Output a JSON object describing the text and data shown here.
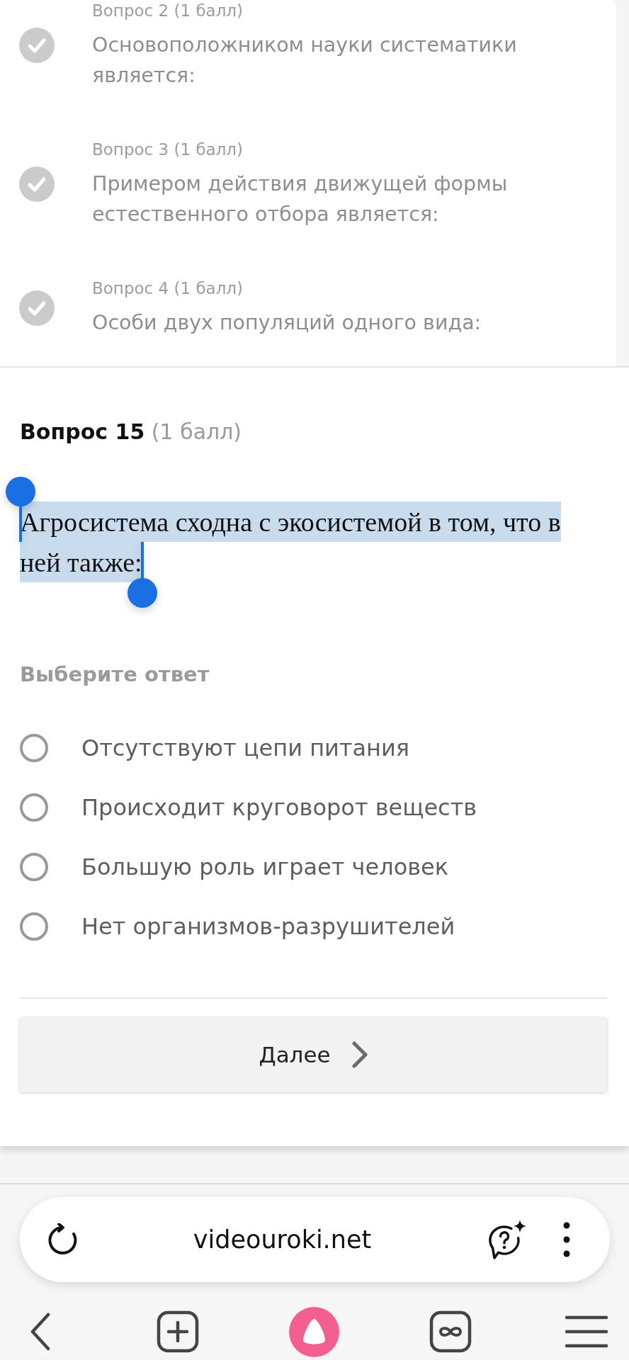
{
  "question_list": {
    "items": [
      {
        "label": "Вопрос 2 (1 балл)",
        "text": "Основоположником науки систематики является:",
        "answered": true
      },
      {
        "label": "Вопрос 3 (1 балл)",
        "text": "Примером действия движущей формы естественного отбора является:",
        "answered": true
      },
      {
        "label": "Вопрос 4 (1 балл)",
        "text": "Особи двух популяций одного вида:",
        "answered": true
      }
    ]
  },
  "question": {
    "number": "Вопрос 15",
    "points": "(1 балл)",
    "text": "Агросистема сходна с экосистемой в том, что в ней также:",
    "text_selected": true
  },
  "answer_prompt": "Выберите ответ",
  "options": [
    {
      "label": "Отсутствуют цепи питания",
      "selected": false
    },
    {
      "label": "Происходит круговорот веществ",
      "selected": false
    },
    {
      "label": "Большую роль играет человек",
      "selected": false
    },
    {
      "label": "Нет организмов-разрушителей",
      "selected": false
    }
  ],
  "next_button": {
    "label": "Далее"
  },
  "browser": {
    "url": "videouroki.net"
  }
}
